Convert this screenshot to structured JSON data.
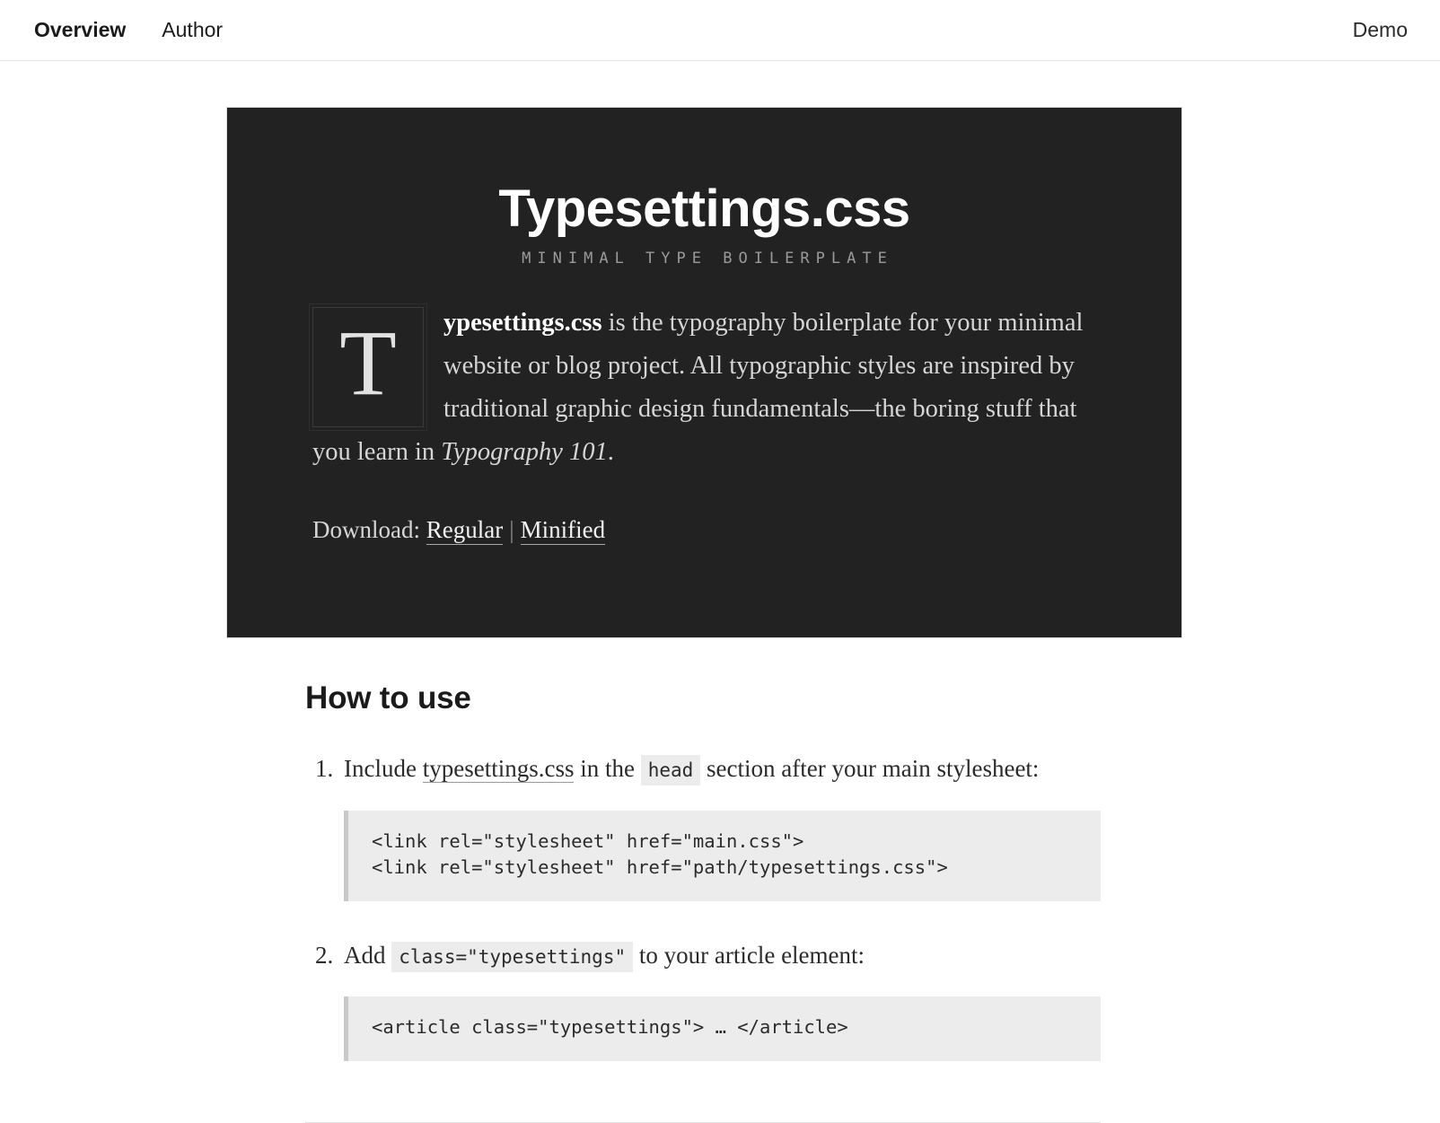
{
  "nav": {
    "left_items": [
      {
        "label": "Overview",
        "active": true
      },
      {
        "label": "Author",
        "active": false
      }
    ],
    "right_items": [
      {
        "label": "Demo"
      }
    ]
  },
  "hero": {
    "title": "Typesettings.css",
    "subtitle": "MINIMAL TYPE BOILERPLATE",
    "dropcap": "T",
    "lead_strong": "ypesettings.css",
    "lead_rest_1": " is the typography boilerplate for your minimal website or blog project. All typographic styles are inspired by traditional graphic design fundamentals—the boring stuff that you learn in ",
    "lead_italic": "Typography 101",
    "lead_rest_2": ".",
    "download_label": "Download:",
    "download_regular": "Regular",
    "download_separator": "|",
    "download_minified": "Minified",
    "background_color": "#222222",
    "text_color": "#d6d6d6"
  },
  "article": {
    "heading": "How to use",
    "steps": [
      {
        "number": "1.",
        "text_before": "Include ",
        "link": "typesettings.css",
        "text_middle": " in the ",
        "code": "head",
        "text_after": " section after your main stylesheet:",
        "codeblock": "<link rel=\"stylesheet\" href=\"main.css\">\n<link rel=\"stylesheet\" href=\"path/typesettings.css\">"
      },
      {
        "number": "2.",
        "text_before": "Add ",
        "link": "",
        "text_middle": "",
        "code": "class=\"typesettings\"",
        "text_after": " to your article element:",
        "codeblock": "<article class=\"typesettings\"> … </article>"
      }
    ]
  },
  "colors": {
    "hero_bg": "#222222",
    "code_bg": "#ececec",
    "code_border": "#c9c9c9",
    "rule": "#e2e2e2",
    "text": "#2b2b2b"
  }
}
